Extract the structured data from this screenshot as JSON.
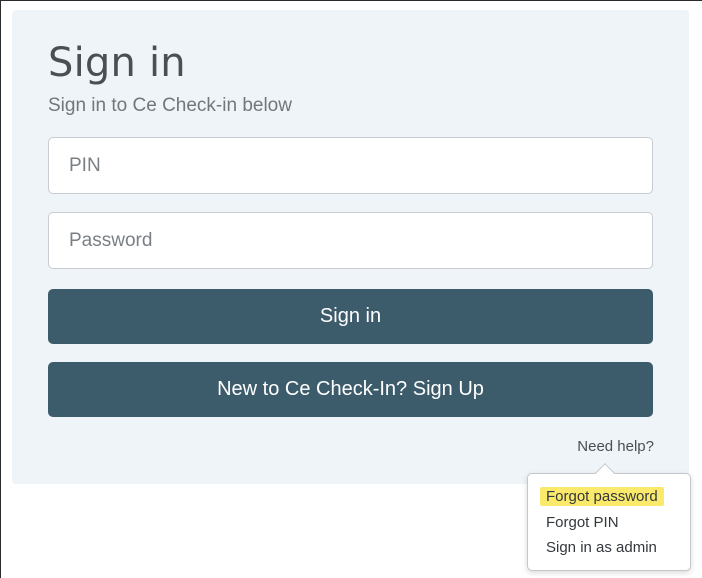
{
  "login": {
    "title": "Sign in",
    "subtitle": "Sign in to Ce Check-in below",
    "pin_placeholder": "PIN",
    "password_placeholder": "Password",
    "signin_label": "Sign in",
    "signup_label": "New to Ce Check-In? Sign Up",
    "help_label": "Need help?"
  },
  "help_menu": {
    "items": [
      {
        "label": "Forgot password",
        "highlighted": true
      },
      {
        "label": "Forgot PIN",
        "highlighted": false
      },
      {
        "label": "Sign in as admin",
        "highlighted": false
      }
    ],
    "highlight_color": "#fbe96b"
  },
  "colors": {
    "button_bg": "#3c5b6b",
    "card_bg": "#eef4f7"
  }
}
